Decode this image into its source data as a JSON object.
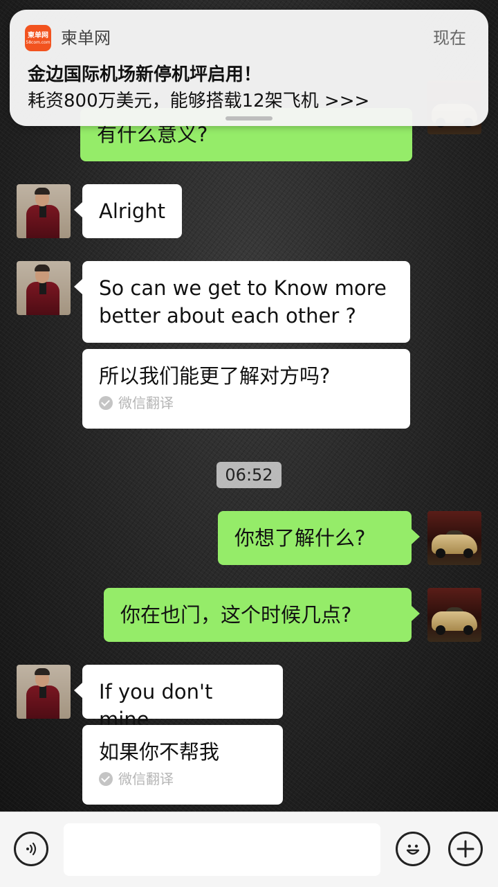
{
  "notification": {
    "app_icon_text": "柬单网",
    "app_icon_subtext": "58com.com",
    "app_name": "柬单网",
    "time": "现在",
    "title": "金边国际机场新停机坪启用！",
    "body": "耗资800万美元，能够搭载12架飞机 >>>"
  },
  "messages": [
    {
      "sender": "me",
      "text": "有什么意义?"
    },
    {
      "sender": "contact",
      "text": "Alright"
    },
    {
      "sender": "contact",
      "text": "So can we get to Know more better about each other ?",
      "lines": [
        "So can we get to Know more",
        "better about each other ?"
      ]
    },
    {
      "sender": "contact",
      "text": "所以我们能更了解对方吗?",
      "translation_label": "微信翻译"
    },
    {
      "sender": "me",
      "text": "你想了解什么?"
    },
    {
      "sender": "me",
      "text": "你在也门，这个时候几点?"
    },
    {
      "sender": "contact",
      "text": "If you don't mine"
    },
    {
      "sender": "contact",
      "text": "如果你不帮我",
      "translation_label": "微信翻译"
    }
  ],
  "timestamp": "06:52",
  "input_bar": {
    "voice_icon": "voice-icon",
    "emoji_icon": "emoji-icon",
    "plus_icon": "plus-icon",
    "input_value": ""
  }
}
